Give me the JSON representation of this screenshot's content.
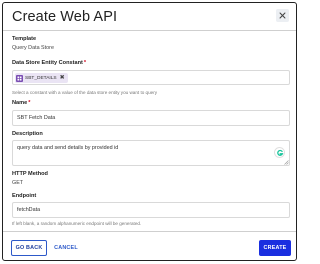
{
  "dialog": {
    "title": "Create Web API",
    "close_icon": "close-icon"
  },
  "template": {
    "label": "Template",
    "value": "Query Data Store"
  },
  "entity_constant": {
    "label": "Data Store Entity Constant",
    "required_mark": "*",
    "chip_label": "SBT_DETAILS",
    "chip_remove": "✖",
    "chip_icon": "entity-icon",
    "hint": "Select a constant with a value of the data store entity you want to query"
  },
  "name": {
    "label": "Name",
    "required_mark": "*",
    "value": "SBT Fetch Data"
  },
  "description": {
    "label": "Description",
    "value": "query data and send details by provided id",
    "assistant_icon": "grammar-assistant-icon"
  },
  "http_method": {
    "label": "HTTP Method",
    "value": "GET"
  },
  "endpoint": {
    "label": "Endpoint",
    "value": "fetchData",
    "hint": "If left blank, a random alphanumeric endpoint will be generated."
  },
  "footer": {
    "back_label": "GO BACK",
    "cancel_label": "CANCEL",
    "create_label": "CREATE"
  },
  "colors": {
    "primary": "#1a2fe0",
    "required": "#d0021b",
    "chip_bg": "#eae4f4",
    "chip_icon": "#7a4db3"
  }
}
